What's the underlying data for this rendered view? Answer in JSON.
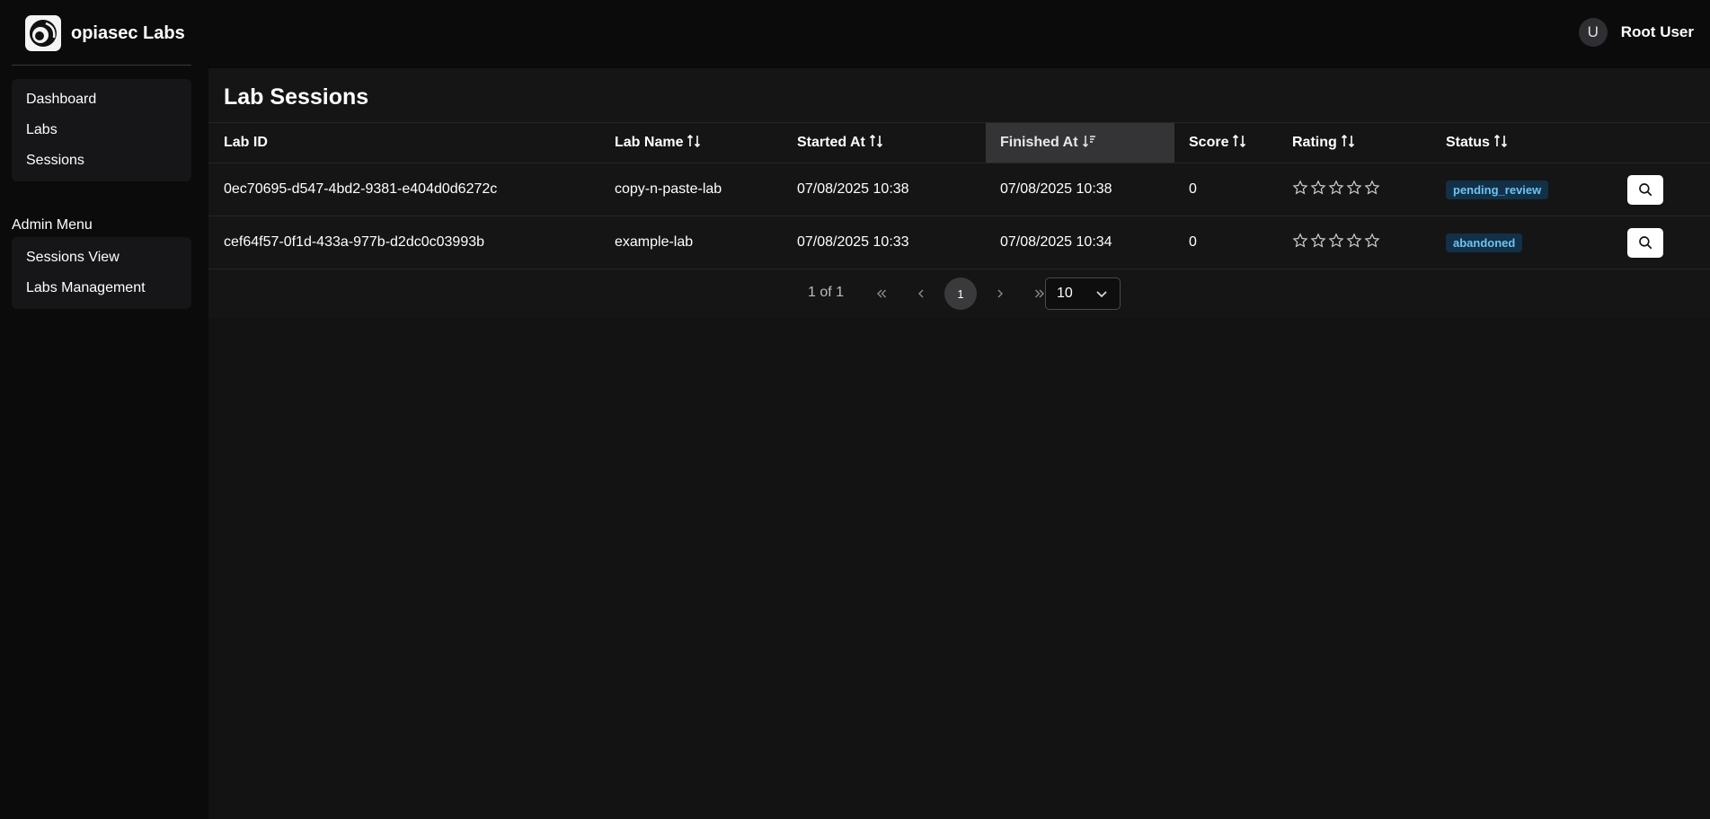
{
  "app": {
    "name": "opiasec Labs"
  },
  "user": {
    "initial": "U",
    "name": "Root User"
  },
  "sidebar": {
    "items": [
      {
        "label": "Dashboard"
      },
      {
        "label": "Labs"
      },
      {
        "label": "Sessions"
      }
    ],
    "admin_title": "Admin Menu",
    "admin_items": [
      {
        "label": "Sessions View"
      },
      {
        "label": "Labs Management"
      }
    ]
  },
  "page": {
    "title": "Lab Sessions"
  },
  "table": {
    "columns": [
      "Lab ID",
      "Lab Name",
      "Started At",
      "Finished At",
      "Score",
      "Rating",
      "Status"
    ],
    "rows": [
      {
        "lab_id": "0ec70695-d547-4bd2-9381-e404d0d6272c",
        "lab_name": "copy-n-paste-lab",
        "started_at": "07/08/2025 10:38",
        "finished_at": "07/08/2025 10:38",
        "score": "0",
        "rating": 0,
        "status": "pending_review"
      },
      {
        "lab_id": "cef64f57-0f1d-433a-977b-d2dc0c03993b",
        "lab_name": "example-lab",
        "started_at": "07/08/2025 10:33",
        "finished_at": "07/08/2025 10:34",
        "score": "0",
        "rating": 0,
        "status": "abandoned"
      }
    ]
  },
  "pagination": {
    "summary": "1 of 1",
    "current_page": "1",
    "page_size": "10"
  },
  "colors": {
    "status_badge_bg": "#123047",
    "status_badge_text": "#6cc4f2",
    "sorted_header_bg": "#343436"
  }
}
